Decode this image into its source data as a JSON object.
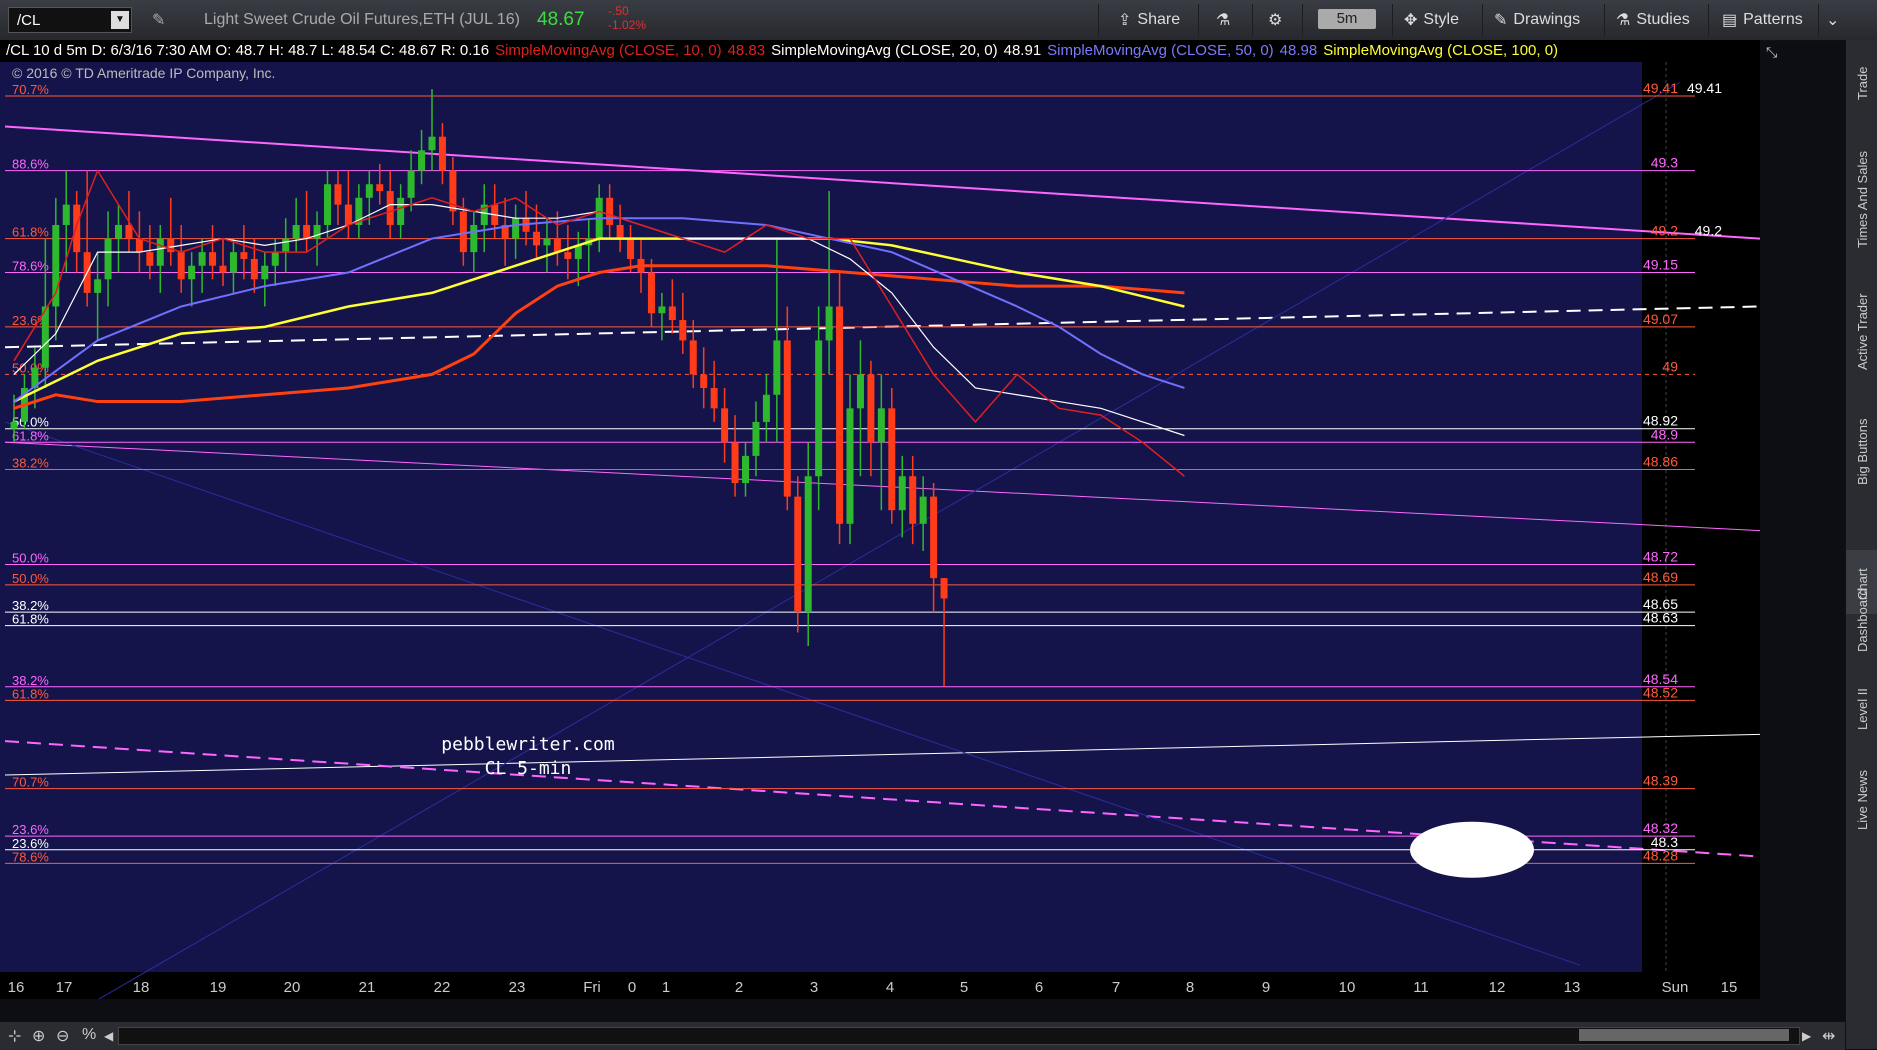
{
  "toolbar": {
    "symbol": "/CL",
    "description": "Light Sweet Crude Oil Futures,ETH (JUL 16)",
    "last": "48.67",
    "change": "-.50",
    "change_pct": "-1.02%",
    "share": "Share",
    "timeframe": "5m",
    "style": "Style",
    "drawings": "Drawings",
    "studies": "Studies",
    "patterns": "Patterns"
  },
  "info": {
    "ohlc": "/CL 10 d 5m  D: 6/3/16 7:30 AM  O: 48.7  H: 48.7  L: 48.54  C: 48.67  R: 0.16",
    "sma10": "SimpleMovingAvg (CLOSE, 10, 0)",
    "sma10v": "48.83",
    "sma20": "SimpleMovingAvg (CLOSE, 20, 0)",
    "sma20v": "48.91",
    "sma50": "SimpleMovingAvg (CLOSE, 50, 0)",
    "sma50v": "48.98",
    "sma100": "SimpleMovingAvg (CLOSE, 100, 0)",
    "sma100v": ""
  },
  "copyright": "© 2016 © TD Ameritrade IP Company, Inc.",
  "watermark": [
    "pebblewriter.com",
    "CL 5-min"
  ],
  "right_rail": [
    "Trade",
    "Times And Sales",
    "Active Trader",
    "Big Buttons",
    "Chart",
    "Dashboard",
    "Level II",
    "Live News"
  ],
  "colors": {
    "bg": "#14144a",
    "up": "#2eb82e",
    "down": "#ff3b1a",
    "sma10": "#e02020",
    "sma20": "#ffffff",
    "sma50": "#7070ff",
    "sma100": "#ffff33",
    "sma100_long": "#ff4010",
    "magenta": "#ff66ff"
  },
  "chart_data": {
    "type": "candlestick",
    "yrange": [
      48.12,
      49.46
    ],
    "y_ticks": [
      49.4,
      49.3,
      49.2,
      49.1,
      49,
      48.9,
      48.8,
      48.7,
      48.6,
      48.5,
      48.4,
      48.3,
      48.2
    ],
    "x_ticks": [
      "16",
      "17",
      "18",
      "19",
      "20",
      "21",
      "22",
      "23",
      "Fri",
      "0",
      "1",
      "2",
      "3",
      "4",
      "5",
      "6",
      "7",
      "8",
      "9",
      "10",
      "11",
      "12",
      "13",
      "Sun",
      "15"
    ],
    "levels": [
      {
        "pct": "70.7%",
        "price": "49.41",
        "color": "#ff5a3c",
        "alt": "49.41"
      },
      {
        "pct": "88.6%",
        "price": "49.3",
        "color": "#ff66ff"
      },
      {
        "pct": "61.8%",
        "price": "49.2",
        "color": "#ff5a3c",
        "alt": "49.2"
      },
      {
        "pct": "78.6%",
        "price": "49.15",
        "color": "#ff66ff"
      },
      {
        "pct": "23.6%",
        "price": "49.07",
        "color": "#ff5a3c"
      },
      {
        "pct": "50.0%",
        "price": "49",
        "color": "#ff5a3c"
      },
      {
        "pct": "50.0%",
        "price": "48.92",
        "color": "#ffffff"
      },
      {
        "pct": "61.8%",
        "price": "48.9",
        "color": "#ff66ff"
      },
      {
        "pct": "38.2%",
        "price": "48.86",
        "color": "#ff5a3c"
      },
      {
        "pct": "50.0%",
        "price": "48.72",
        "color": "#ff66ff"
      },
      {
        "pct": "50.0%",
        "price": "48.69",
        "color": "#ff5a3c"
      },
      {
        "pct": "38.2%",
        "price": "48.65",
        "color": "#ffffff"
      },
      {
        "pct": "61.8%",
        "price": "48.63",
        "color": "#ffffff"
      },
      {
        "pct": "38.2%",
        "price": "48.54",
        "color": "#ff66ff"
      },
      {
        "pct": "61.8%",
        "price": "48.52",
        "color": "#ff5a3c"
      },
      {
        "pct": "70.7%",
        "price": "48.39",
        "color": "#ff5a3c"
      },
      {
        "pct": "23.6%",
        "price": "48.32",
        "color": "#ff66ff"
      },
      {
        "pct": "23.6%",
        "price": "48.3",
        "color": "#ffffff"
      },
      {
        "pct": "78.6%",
        "price": "48.28",
        "color": "#ff5a3c"
      }
    ],
    "price_badges": [
      {
        "price": "49.1",
        "bg": "#ffff00",
        "fg": "#000"
      },
      {
        "price": "48.98",
        "bg": "#6a6aff",
        "fg": "#fff"
      },
      {
        "price": "48.91",
        "bg": "#ffffff",
        "fg": "#000"
      },
      {
        "price": "48.83",
        "bg": "#cc1a1a",
        "fg": "#fff"
      },
      {
        "price": "48.67",
        "bg": "#ff3b1a",
        "fg": "#fff"
      }
    ],
    "sma10": [
      [
        0,
        49.02
      ],
      [
        4,
        49.12
      ],
      [
        6,
        49.22
      ],
      [
        8,
        49.3
      ],
      [
        12,
        49.2
      ],
      [
        16,
        49.18
      ],
      [
        20,
        49.2
      ],
      [
        24,
        49.18
      ],
      [
        28,
        49.18
      ],
      [
        32,
        49.22
      ],
      [
        36,
        49.24
      ],
      [
        40,
        49.26
      ],
      [
        44,
        49.24
      ],
      [
        48,
        49.26
      ],
      [
        52,
        49.22
      ],
      [
        56,
        49.24
      ],
      [
        60,
        49.22
      ],
      [
        64,
        49.2
      ],
      [
        68,
        49.18
      ],
      [
        72,
        49.22
      ],
      [
        76,
        49.2
      ],
      [
        80,
        49.2
      ],
      [
        84,
        49.1
      ],
      [
        88,
        49.0
      ],
      [
        92,
        48.93
      ],
      [
        96,
        49.0
      ],
      [
        100,
        48.95
      ],
      [
        104,
        48.94
      ],
      [
        108,
        48.9
      ],
      [
        112,
        48.85
      ]
    ],
    "sma20": [
      [
        0,
        49.0
      ],
      [
        4,
        49.06
      ],
      [
        6,
        49.12
      ],
      [
        8,
        49.18
      ],
      [
        12,
        49.18
      ],
      [
        16,
        49.19
      ],
      [
        20,
        49.2
      ],
      [
        24,
        49.19
      ],
      [
        28,
        49.2
      ],
      [
        32,
        49.22
      ],
      [
        36,
        49.25
      ],
      [
        40,
        49.25
      ],
      [
        44,
        49.24
      ],
      [
        48,
        49.23
      ],
      [
        52,
        49.23
      ],
      [
        56,
        49.24
      ],
      [
        60,
        49.22
      ],
      [
        64,
        49.2
      ],
      [
        68,
        49.2
      ],
      [
        72,
        49.2
      ],
      [
        76,
        49.2
      ],
      [
        80,
        49.17
      ],
      [
        84,
        49.12
      ],
      [
        88,
        49.04
      ],
      [
        92,
        48.98
      ],
      [
        96,
        48.97
      ],
      [
        100,
        48.96
      ],
      [
        104,
        48.95
      ],
      [
        108,
        48.93
      ],
      [
        112,
        48.91
      ]
    ],
    "sma50": [
      [
        0,
        48.96
      ],
      [
        8,
        49.05
      ],
      [
        16,
        49.1
      ],
      [
        24,
        49.13
      ],
      [
        32,
        49.15
      ],
      [
        40,
        49.2
      ],
      [
        48,
        49.22
      ],
      [
        56,
        49.23
      ],
      [
        64,
        49.23
      ],
      [
        72,
        49.22
      ],
      [
        78,
        49.2
      ],
      [
        84,
        49.18
      ],
      [
        90,
        49.14
      ],
      [
        96,
        49.1
      ],
      [
        100,
        49.07
      ],
      [
        104,
        49.03
      ],
      [
        108,
        49.0
      ],
      [
        112,
        48.98
      ]
    ],
    "sma100": [
      [
        0,
        48.96
      ],
      [
        8,
        49.02
      ],
      [
        16,
        49.06
      ],
      [
        24,
        49.07
      ],
      [
        32,
        49.1
      ],
      [
        40,
        49.12
      ],
      [
        48,
        49.16
      ],
      [
        56,
        49.2
      ],
      [
        64,
        49.2
      ],
      [
        72,
        49.2
      ],
      [
        78,
        49.2
      ],
      [
        84,
        49.19
      ],
      [
        90,
        49.17
      ],
      [
        96,
        49.15
      ],
      [
        104,
        49.13
      ],
      [
        112,
        49.1
      ]
    ],
    "sma_long": [
      [
        0,
        48.95
      ],
      [
        4,
        48.97
      ],
      [
        8,
        48.96
      ],
      [
        16,
        48.96
      ],
      [
        24,
        48.97
      ],
      [
        32,
        48.98
      ],
      [
        40,
        49.0
      ],
      [
        44,
        49.03
      ],
      [
        48,
        49.09
      ],
      [
        52,
        49.13
      ],
      [
        56,
        49.15
      ],
      [
        60,
        49.16
      ],
      [
        64,
        49.16
      ],
      [
        72,
        49.16
      ],
      [
        80,
        49.15
      ],
      [
        88,
        49.14
      ],
      [
        96,
        49.13
      ],
      [
        104,
        49.13
      ],
      [
        112,
        49.12
      ]
    ],
    "candles": [
      [
        48.92,
        48.97,
        48.9,
        48.93
      ],
      [
        48.93,
        49.0,
        48.92,
        48.98
      ],
      [
        48.98,
        49.04,
        48.95,
        49.01
      ],
      [
        49.01,
        49.2,
        48.98,
        49.1
      ],
      [
        49.1,
        49.26,
        49.05,
        49.22
      ],
      [
        49.22,
        49.3,
        49.15,
        49.25
      ],
      [
        49.25,
        49.27,
        49.15,
        49.18
      ],
      [
        49.18,
        49.3,
        49.1,
        49.12
      ],
      [
        49.12,
        49.18,
        49.05,
        49.14
      ],
      [
        49.14,
        49.24,
        49.1,
        49.2
      ],
      [
        49.2,
        49.25,
        49.15,
        49.22
      ],
      [
        49.22,
        49.27,
        49.18,
        49.2
      ],
      [
        49.2,
        49.24,
        49.15,
        49.18
      ],
      [
        49.18,
        49.22,
        49.14,
        49.16
      ],
      [
        49.16,
        49.22,
        49.12,
        49.2
      ],
      [
        49.2,
        49.26,
        49.16,
        49.18
      ],
      [
        49.18,
        49.22,
        49.12,
        49.14
      ],
      [
        49.14,
        49.18,
        49.1,
        49.16
      ],
      [
        49.16,
        49.2,
        49.12,
        49.18
      ],
      [
        49.18,
        49.22,
        49.14,
        49.16
      ],
      [
        49.16,
        49.2,
        49.13,
        49.15
      ],
      [
        49.15,
        49.2,
        49.12,
        49.18
      ],
      [
        49.18,
        49.22,
        49.14,
        49.17
      ],
      [
        49.17,
        49.2,
        49.12,
        49.14
      ],
      [
        49.14,
        49.18,
        49.1,
        49.16
      ],
      [
        49.16,
        49.2,
        49.13,
        49.18
      ],
      [
        49.18,
        49.23,
        49.15,
        49.2
      ],
      [
        49.2,
        49.26,
        49.18,
        49.22
      ],
      [
        49.22,
        49.27,
        49.18,
        49.2
      ],
      [
        49.2,
        49.24,
        49.16,
        49.22
      ],
      [
        49.22,
        49.3,
        49.2,
        49.28
      ],
      [
        49.28,
        49.3,
        49.22,
        49.25
      ],
      [
        49.25,
        49.3,
        49.2,
        49.22
      ],
      [
        49.22,
        49.28,
        49.2,
        49.26
      ],
      [
        49.26,
        49.3,
        49.22,
        49.28
      ],
      [
        49.28,
        49.31,
        49.25,
        49.27
      ],
      [
        49.27,
        49.3,
        49.2,
        49.22
      ],
      [
        49.22,
        49.28,
        49.2,
        49.26
      ],
      [
        49.26,
        49.33,
        49.24,
        49.3
      ],
      [
        49.3,
        49.36,
        49.28,
        49.33
      ],
      [
        49.33,
        49.42,
        49.3,
        49.35
      ],
      [
        49.35,
        49.37,
        49.28,
        49.3
      ],
      [
        49.3,
        49.32,
        49.22,
        49.24
      ],
      [
        49.24,
        49.26,
        49.16,
        49.18
      ],
      [
        49.18,
        49.24,
        49.15,
        49.22
      ],
      [
        49.22,
        49.28,
        49.18,
        49.25
      ],
      [
        49.25,
        49.28,
        49.2,
        49.22
      ],
      [
        49.22,
        49.26,
        49.16,
        49.2
      ],
      [
        49.2,
        49.25,
        49.17,
        49.23
      ],
      [
        49.23,
        49.27,
        49.19,
        49.21
      ],
      [
        49.21,
        49.25,
        49.17,
        49.19
      ],
      [
        49.19,
        49.23,
        49.15,
        49.2
      ],
      [
        49.2,
        49.24,
        49.16,
        49.18
      ],
      [
        49.18,
        49.22,
        49.14,
        49.17
      ],
      [
        49.17,
        49.21,
        49.13,
        49.19
      ],
      [
        49.19,
        49.23,
        49.15,
        49.2
      ],
      [
        49.2,
        49.28,
        49.18,
        49.26
      ],
      [
        49.26,
        49.28,
        49.2,
        49.22
      ],
      [
        49.22,
        49.25,
        49.18,
        49.2
      ],
      [
        49.2,
        49.22,
        49.15,
        49.17
      ],
      [
        49.17,
        49.2,
        49.12,
        49.15
      ],
      [
        49.15,
        49.17,
        49.07,
        49.09
      ],
      [
        49.09,
        49.12,
        49.05,
        49.1
      ],
      [
        49.1,
        49.14,
        49.06,
        49.08
      ],
      [
        49.08,
        49.12,
        49.03,
        49.05
      ],
      [
        49.05,
        49.08,
        48.98,
        49.0
      ],
      [
        49.0,
        49.04,
        48.95,
        48.98
      ],
      [
        48.98,
        49.02,
        48.93,
        48.95
      ],
      [
        48.95,
        48.98,
        48.87,
        48.9
      ],
      [
        48.9,
        48.94,
        48.82,
        48.84
      ],
      [
        48.84,
        48.9,
        48.82,
        48.88
      ],
      [
        48.88,
        48.96,
        48.85,
        48.93
      ],
      [
        48.93,
        49.0,
        48.9,
        48.97
      ],
      [
        48.97,
        49.2,
        48.9,
        49.05
      ],
      [
        49.05,
        49.1,
        48.8,
        48.82
      ],
      [
        48.82,
        48.85,
        48.62,
        48.65
      ],
      [
        48.65,
        48.9,
        48.6,
        48.85
      ],
      [
        48.85,
        49.1,
        48.8,
        49.05
      ],
      [
        49.05,
        49.27,
        49.0,
        49.1
      ],
      [
        49.1,
        49.15,
        48.75,
        48.78
      ],
      [
        48.78,
        49.0,
        48.75,
        48.95
      ],
      [
        48.95,
        49.05,
        48.85,
        49.0
      ],
      [
        49.0,
        49.02,
        48.85,
        48.9
      ],
      [
        48.9,
        49.0,
        48.8,
        48.95
      ],
      [
        48.95,
        48.98,
        48.78,
        48.8
      ],
      [
        48.8,
        48.88,
        48.76,
        48.85
      ],
      [
        48.85,
        48.88,
        48.75,
        48.78
      ],
      [
        48.78,
        48.85,
        48.74,
        48.82
      ],
      [
        48.82,
        48.84,
        48.65,
        48.7
      ],
      [
        48.7,
        48.7,
        48.54,
        48.67
      ]
    ]
  }
}
